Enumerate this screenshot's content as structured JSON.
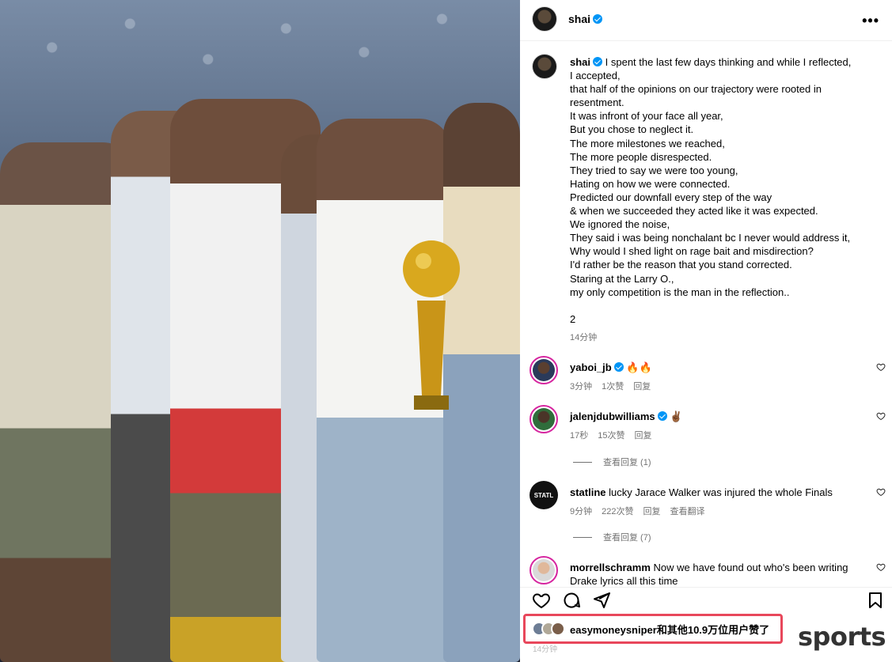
{
  "post": {
    "author": "shai",
    "caption_lines": [
      "I spent the last few days thinking and while I reflected,",
      "I accepted,",
      "that half of the opinions on our trajectory were rooted in",
      "resentment.",
      "It was infront of your face all year,",
      "But you chose to neglect it.",
      "The more milestones we reached,",
      "The more people disrespected.",
      "They tried to say we were too young,",
      "Hating on how we were connected.",
      "Predicted our downfall every step of the way",
      "& when we succeeded they acted like it was expected.",
      "We ignored the noise,",
      "They said i was being nonchalant bc I never would address it,",
      "Why would I shed light on rage bait and misdirection?",
      "I'd rather be the reason that you stand corrected.",
      "Staring at the Larry O.,",
      "my only competition is the man in the reflection.."
    ],
    "caption_number": "2",
    "caption_time": "14分钟"
  },
  "comments": [
    {
      "user": "yaboi_jb",
      "verified": true,
      "text": "🔥🔥",
      "time": "3分钟",
      "likes": "1次赞",
      "reply": "回复"
    },
    {
      "user": "jalenjdubwilliams",
      "verified": true,
      "text": "✌🏾",
      "time": "17秒",
      "likes": "15次赞",
      "reply": "回复",
      "view_replies": "查看回复 (1)"
    },
    {
      "user": "statline",
      "verified": false,
      "text": "lucky Jarace Walker was injured the whole Finals",
      "time": "9分钟",
      "likes": "222次赞",
      "reply": "回复",
      "translate": "查看翻译",
      "view_replies": "查看回复 (7)"
    },
    {
      "user": "morrellschramm",
      "verified": false,
      "text": "Now we have found out who's been writing Drake lyrics all this time"
    }
  ],
  "likes": {
    "text": "easymoneysniper和其他10.9万位用户赞了",
    "time": "14分钟"
  },
  "watermark": "sports",
  "colors": {
    "highlight": "#e8475b",
    "verified": "#0095f6"
  }
}
